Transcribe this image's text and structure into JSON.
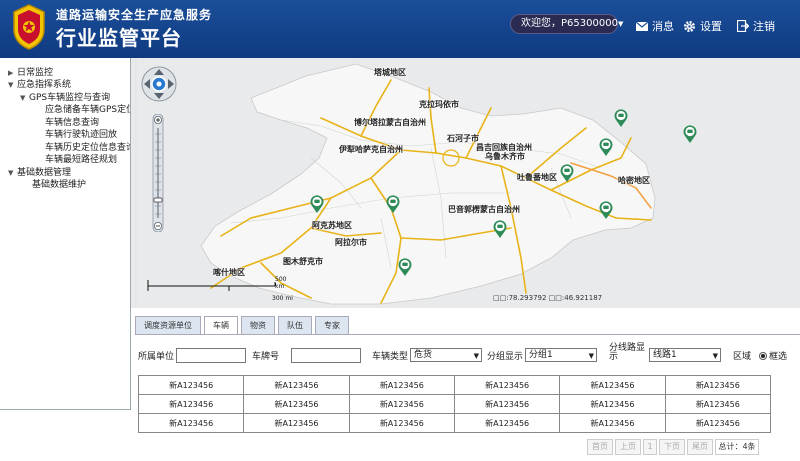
{
  "header": {
    "subtitle": "道路运输安全生产应急服务",
    "title": "行业监管平台",
    "welcome": "欢迎您，P65300000",
    "messages": "消息",
    "settings": "设置",
    "logout": "注销"
  },
  "sidebar": {
    "items": [
      "日常监控",
      "应急指挥系统",
      "GPS车辆监控与查询",
      "应急储备车辆GPS定位查询",
      "车辆信息查询",
      "车辆行驶轨迹回放",
      "车辆历史定位信息查询",
      "车辆最短路径规划",
      "基础数据管理",
      "基础数据维护"
    ]
  },
  "map": {
    "cities": [
      "塔城地区",
      "克拉玛依市",
      "博尔塔拉蒙古自治州",
      "石河子市",
      "伊犁哈萨克自治州",
      "昌吉回族自治州",
      "乌鲁木齐市",
      "吐鲁番地区",
      "哈密地区",
      "巴音郭楞蒙古自治州",
      "阿克苏地区",
      "阿拉尔市",
      "图木舒克市",
      "喀什地区"
    ],
    "scale_km": "500 km",
    "scale_mi": "300 mi",
    "coords": "□□:78.293792 □□:46.921187"
  },
  "tabs": [
    "调度资源单位",
    "车辆",
    "物资",
    "队伍",
    "专家"
  ],
  "filters": {
    "unit_label": "所属单位",
    "plate_label": "车牌号",
    "type_label": "车辆类型",
    "type_value": "危货",
    "group_label": "分组显示",
    "group_value": "分组1",
    "route_label": "分线路显示",
    "route_value": "线路1",
    "area_label": "区域",
    "box_label": "框选"
  },
  "table": {
    "rows": [
      [
        "新A123456",
        "新A123456",
        "新A123456",
        "新A123456",
        "新A123456",
        "新A123456"
      ],
      [
        "新A123456",
        "新A123456",
        "新A123456",
        "新A123456",
        "新A123456",
        "新A123456"
      ],
      [
        "新A123456",
        "新A123456",
        "新A123456",
        "新A123456",
        "新A123456",
        "新A123456"
      ]
    ]
  },
  "pager": {
    "first": "首页",
    "prev": "上页",
    "page": "1",
    "next": "下页",
    "last": "尾页",
    "total": "总计：4条"
  }
}
